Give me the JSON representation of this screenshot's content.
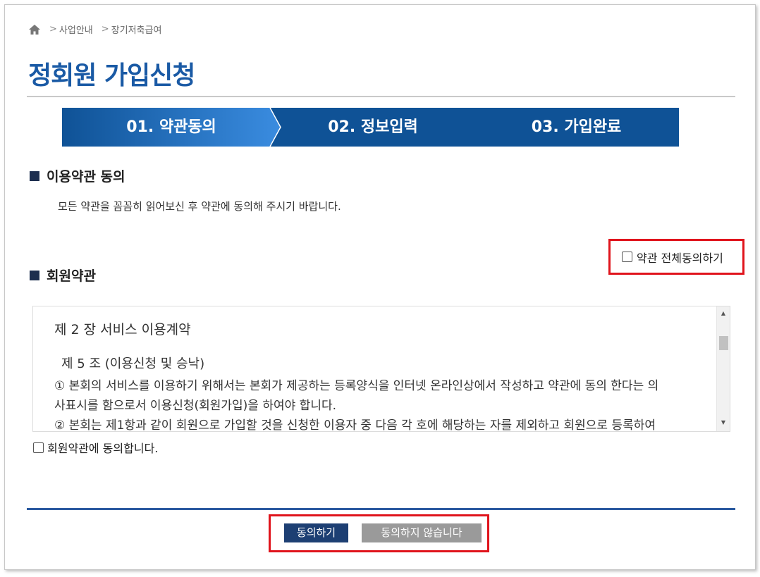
{
  "breadcrumb": {
    "home_icon": "home-icon",
    "items": [
      "사업안내",
      "장기저축급여"
    ]
  },
  "page_title": "정회원 가입신청",
  "steps": [
    "01. 약관동의",
    "02. 정보입력",
    "03. 가입완료"
  ],
  "active_step": 0,
  "colors": {
    "primary": "#0f5296",
    "active_step": "#2f7fd6",
    "title": "#1a5aa5",
    "highlight": "#e0141c",
    "agree_btn": "#1d3f73",
    "disagree_btn": "#9a9a9a"
  },
  "terms_section": {
    "heading": "이용약관 동의",
    "description": "모든 약관을 꼼꼼히 읽어보신 후 약관에 동의해 주시기 바랍니다.",
    "all_agree_label": "약관 전체동의하기"
  },
  "member_terms": {
    "heading": "회원약관",
    "chapter": "제 2 장 서비스 이용계약",
    "article": "제 5 조 (이용신청 및 승낙)",
    "paragraph1_line1": "① 본회의 서비스를 이용하기 위해서는 본회가 제공하는 등록양식을 인터넷 온라인상에서 작성하고 약관에 동의 한다는 의",
    "paragraph1_line2": "사표시를 함으로서 이용신청(회원가입)을 하여야 합니다.",
    "paragraph2_partial": "② 본회는 제1항과 같이 회원으로 가입할 것을 신청한 이용자 중 다음 각 호에 해당하는 자를 제외하고 회원으로 등록하여",
    "agree_label": "회원약관에 동의합니다."
  },
  "buttons": {
    "agree": "동의하기",
    "disagree": "동의하지 않습니다"
  }
}
